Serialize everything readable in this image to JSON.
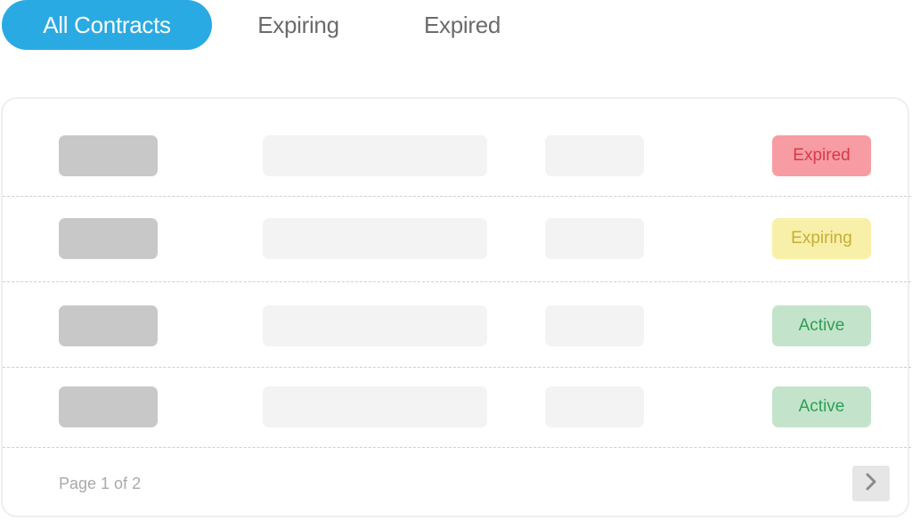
{
  "tabs": [
    {
      "label": "All Contracts",
      "active": true
    },
    {
      "label": "Expiring",
      "active": false
    },
    {
      "label": "Expired",
      "active": false
    }
  ],
  "rows": [
    {
      "status": "Expired",
      "status_type": "expired"
    },
    {
      "status": "Expiring",
      "status_type": "expiring"
    },
    {
      "status": "Active",
      "status_type": "active"
    },
    {
      "status": "Active",
      "status_type": "active"
    }
  ],
  "pagination": {
    "label": "Page 1 of 2",
    "current_page": 1,
    "total_pages": 2,
    "next_icon": "chevron-right-icon"
  },
  "colors": {
    "accent": "#2aaae2",
    "expired_bg": "#f79ca2",
    "expired_text": "#d83a4a",
    "expiring_bg": "#f8f0a8",
    "expiring_text": "#c8ad35",
    "active_bg": "#c3e4cb",
    "active_text": "#2f9e57"
  }
}
